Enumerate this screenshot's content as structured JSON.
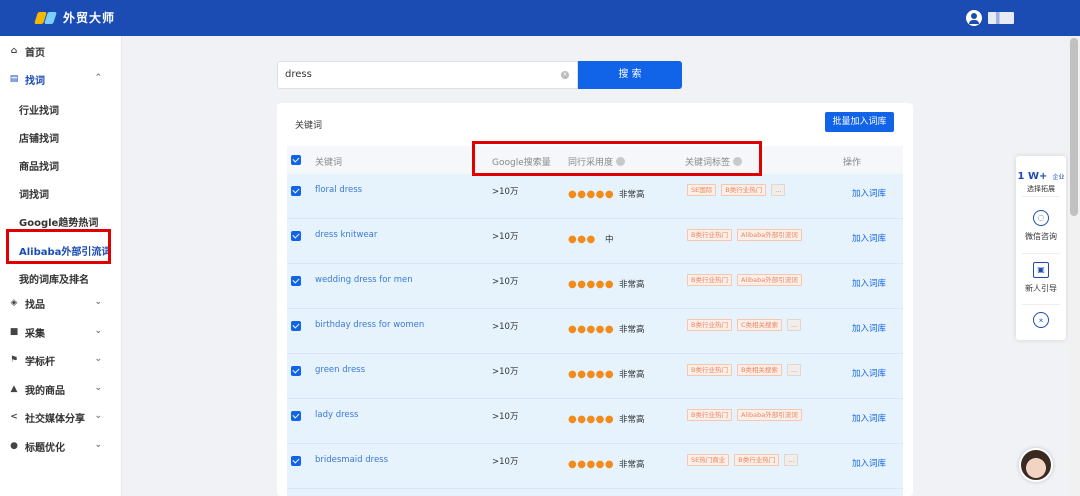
{
  "header": {
    "app_name": "外贸大师"
  },
  "sidebar": {
    "home": "首页",
    "find_words": "找词",
    "sub_items": [
      "行业找词",
      "店铺找词",
      "商品找词",
      "词找词",
      "Google趋势热词",
      "Alibaba外部引流词",
      "我的词库及排名"
    ],
    "groups": [
      "找品",
      "采集",
      "学标杆",
      "我的商品",
      "社交媒体分享",
      "标题优化"
    ]
  },
  "search": {
    "value": "dress",
    "button": "搜 索"
  },
  "table": {
    "section_title": "关键词",
    "batch_button": "批量加入词库",
    "headers": {
      "keyword": "关键词",
      "google_volume": "Google搜索量",
      "peer_adoption": "同行采用度",
      "keyword_tags": "关键词标签",
      "action": "操作"
    },
    "rows": [
      {
        "keyword": "floral dress",
        "volume": ">10万",
        "dots": "●●●●●",
        "level": "非常高",
        "tags": [
          "SE国际",
          "B类行业热门",
          "..."
        ],
        "action": "加入词库"
      },
      {
        "keyword": "dress knitwear",
        "volume": ">10万",
        "dots": "●●●",
        "level": "中",
        "tags": [
          "B类行业热门",
          "Alibaba外部引流词"
        ],
        "action": "加入词库"
      },
      {
        "keyword": "wedding dress for men",
        "volume": ">10万",
        "dots": "●●●●●",
        "level": "非常高",
        "tags": [
          "B类行业热门",
          "Alibaba外部引流词"
        ],
        "action": "加入词库"
      },
      {
        "keyword": "birthday dress for women",
        "volume": ">10万",
        "dots": "●●●●●",
        "level": "非常高",
        "tags": [
          "B类行业热门",
          "C类相关搜索",
          "..."
        ],
        "action": "加入词库"
      },
      {
        "keyword": "green dress",
        "volume": ">10万",
        "dots": "●●●●●",
        "level": "非常高",
        "tags": [
          "B类行业热门",
          "B类相关搜索",
          "..."
        ],
        "action": "加入词库"
      },
      {
        "keyword": "lady dress",
        "volume": ">10万",
        "dots": "●●●●●",
        "level": "非常高",
        "tags": [
          "B类行业热门",
          "Alibaba外部引流词"
        ],
        "action": "加入词库"
      },
      {
        "keyword": "bridesmaid dress",
        "volume": ">10万",
        "dots": "●●●●●",
        "level": "非常高",
        "tags": [
          "SE热门商业",
          "B类行业热门",
          "..."
        ],
        "action": "加入词库"
      }
    ]
  },
  "float_panel": {
    "top_big": "1 W+",
    "top_small": "企业",
    "top_sub": "选择拓展",
    "wechat": "微信咨询",
    "newbie": "新人引导"
  },
  "colors": {
    "header_blue": "#1a4cb4",
    "button_blue": "#1163e8",
    "row_bg": "#e6f3fd",
    "dot_orange": "#f28b1a",
    "highlight_red": "#e00000"
  }
}
